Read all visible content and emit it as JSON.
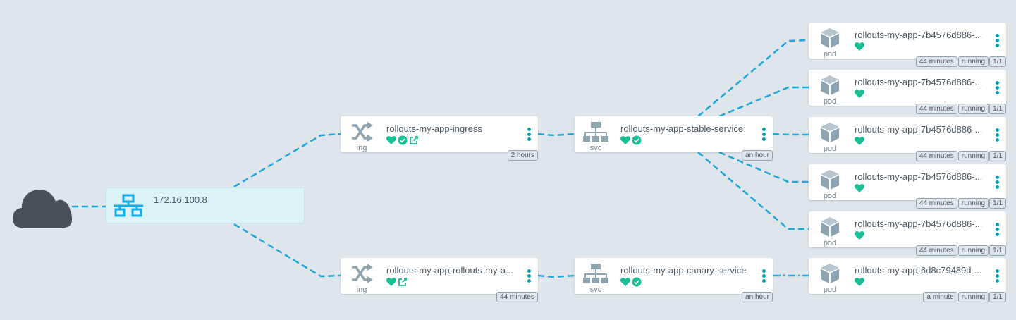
{
  "load_balancer": {
    "ip": "172.16.100.8"
  },
  "ingresses": [
    {
      "name": "rollouts-my-app-ingress",
      "kind": "ing",
      "age": "2 hours",
      "status": [
        "healthy",
        "synced",
        "external-link"
      ]
    },
    {
      "name": "rollouts-my-app-rollouts-my-a...",
      "kind": "ing",
      "age": "44 minutes",
      "status": [
        "healthy",
        "external-link"
      ]
    }
  ],
  "services": [
    {
      "name": "rollouts-my-app-stable-service",
      "kind": "svc",
      "age": "an hour",
      "status": [
        "healthy",
        "synced"
      ]
    },
    {
      "name": "rollouts-my-app-canary-service",
      "kind": "svc",
      "age": "an hour",
      "status": [
        "healthy",
        "synced"
      ]
    }
  ],
  "pods": [
    {
      "name": "rollouts-my-app-7b4576d886-...",
      "kind": "pod",
      "age": "44 minutes",
      "state": "running",
      "ready": "1/1"
    },
    {
      "name": "rollouts-my-app-7b4576d886-...",
      "kind": "pod",
      "age": "44 minutes",
      "state": "running",
      "ready": "1/1"
    },
    {
      "name": "rollouts-my-app-7b4576d886-...",
      "kind": "pod",
      "age": "44 minutes",
      "state": "running",
      "ready": "1/1"
    },
    {
      "name": "rollouts-my-app-7b4576d886-...",
      "kind": "pod",
      "age": "44 minutes",
      "state": "running",
      "ready": "1/1"
    },
    {
      "name": "rollouts-my-app-7b4576d886-...",
      "kind": "pod",
      "age": "44 minutes",
      "state": "running",
      "ready": "1/1"
    },
    {
      "name": "rollouts-my-app-6d8c79489d-...",
      "kind": "pod",
      "age": "a minute",
      "state": "running",
      "ready": "1/1"
    }
  ],
  "colors": {
    "edge": "#1fa7d8",
    "healthy": "#18be94",
    "icon_gray": "#8fa4b1",
    "menu": "#00a2b3",
    "cloud": "#485058",
    "lb_icon": "#0dadea"
  }
}
